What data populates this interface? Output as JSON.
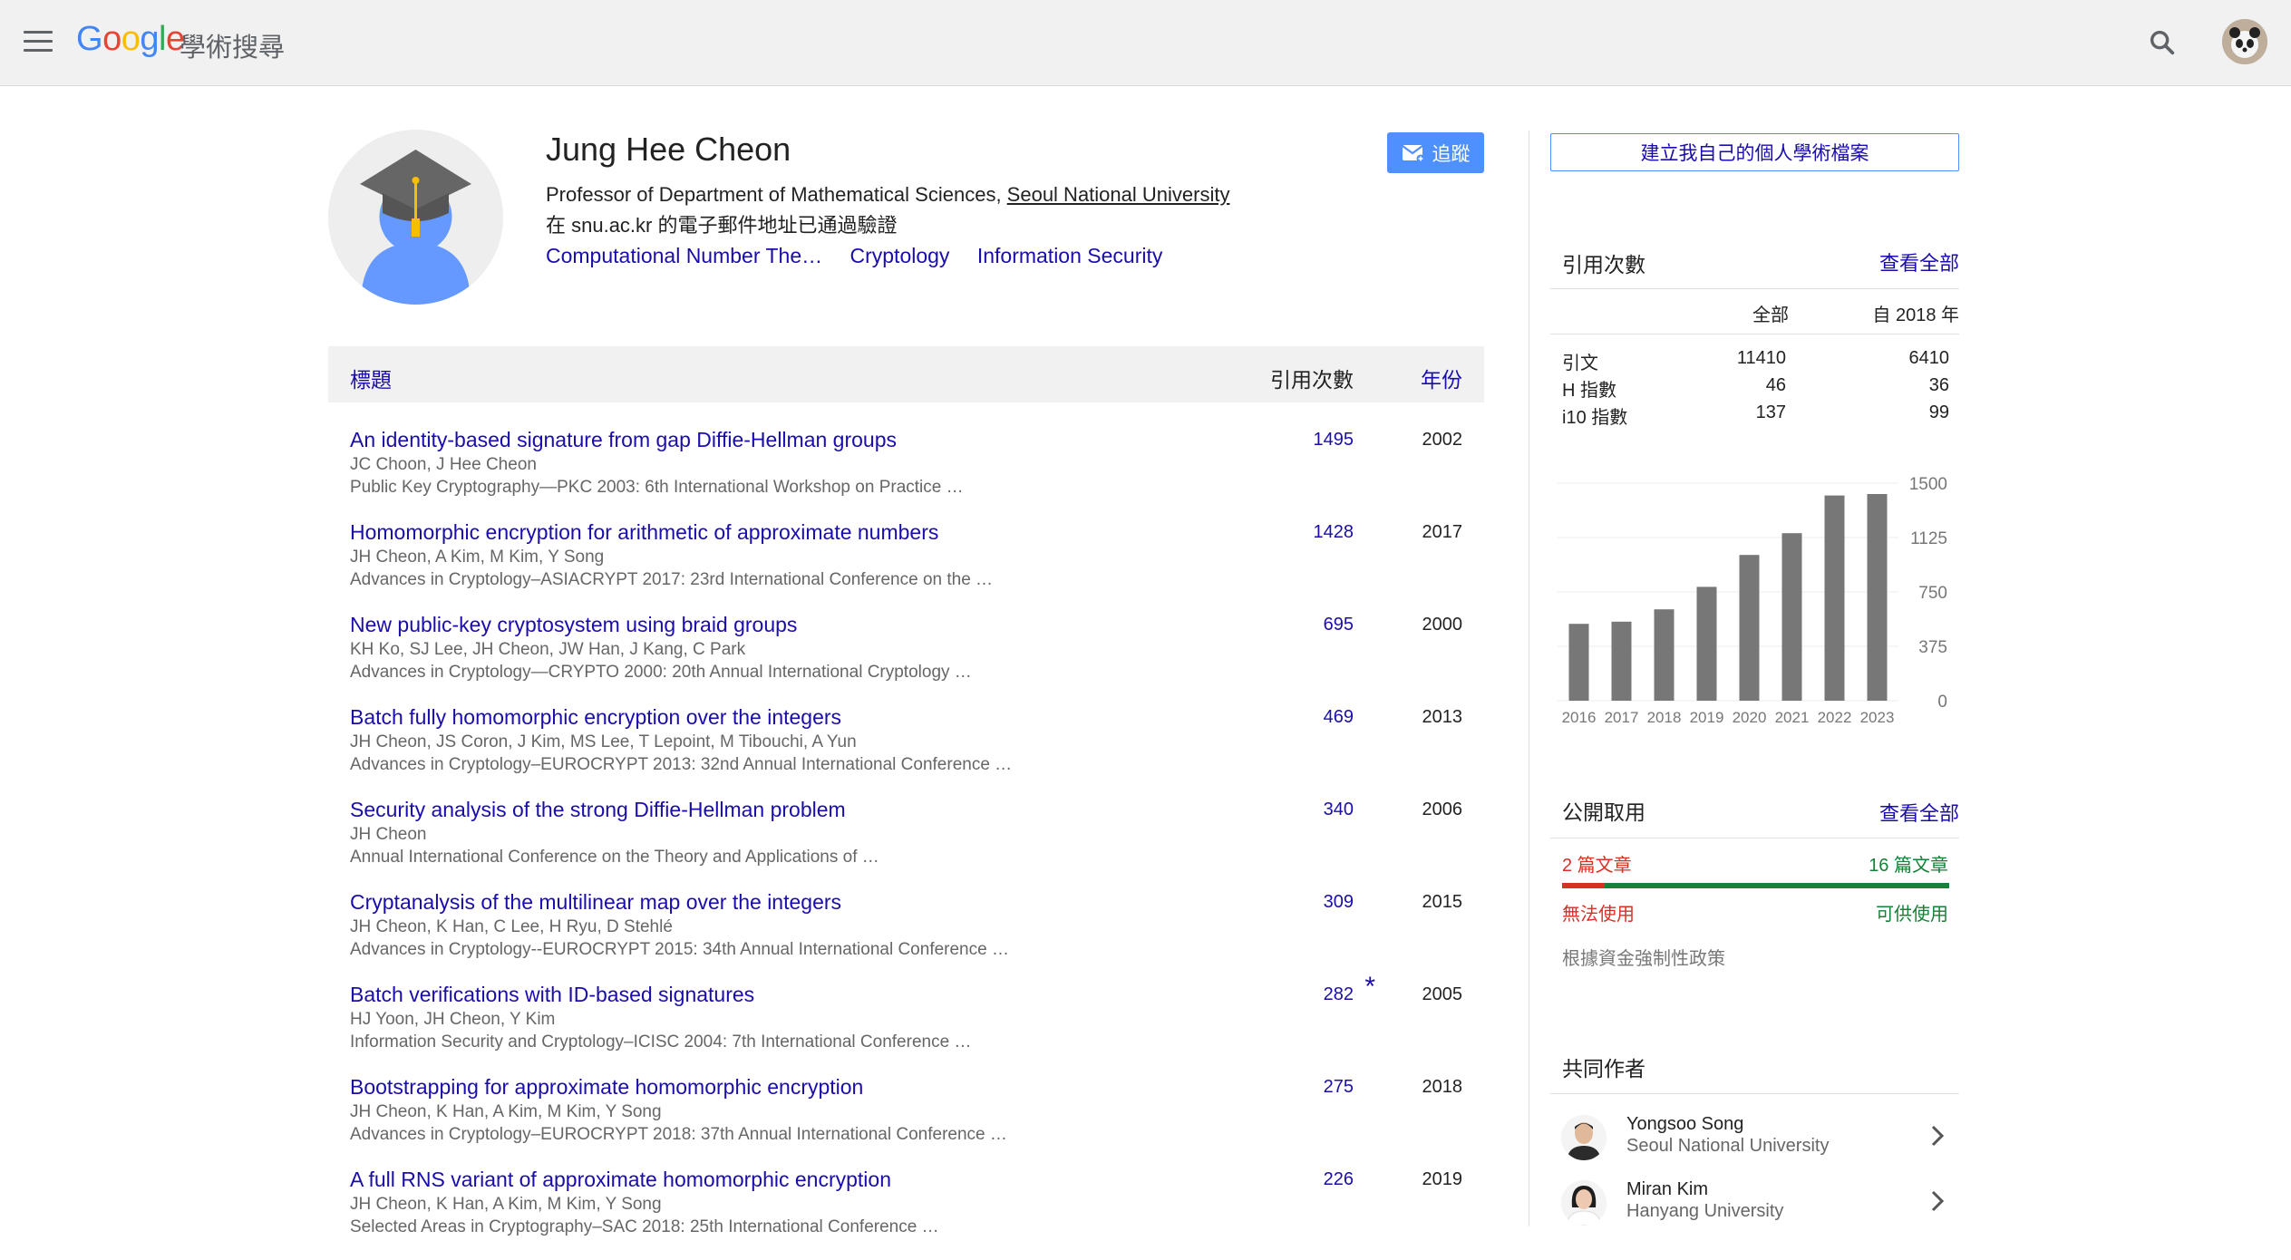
{
  "header": {
    "logo_letters": [
      "G",
      "o",
      "o",
      "g",
      "l",
      "e"
    ],
    "logo_sub": "學術搜尋"
  },
  "profile": {
    "name": "Jung Hee Cheon",
    "affiliation_prefix": "Professor of Department of Mathematical Sciences, ",
    "affiliation_link": "Seoul National University",
    "verified": "在 snu.ac.kr 的電子郵件地址已通過驗證",
    "interests": [
      "Computational Number The…",
      "Cryptology",
      "Information Security"
    ],
    "follow_label": "追蹤"
  },
  "table": {
    "col_title": "標題",
    "col_cited": "引用次數",
    "col_year": "年份",
    "rows": [
      {
        "title": "An identity-based signature from gap Diffie-Hellman groups",
        "authors": "JC Choon, J Hee Cheon",
        "venue": "Public Key Cryptography—PKC 2003: 6th International Workshop on Practice …",
        "cited": "1495",
        "year": "2002",
        "star": ""
      },
      {
        "title": "Homomorphic encryption for arithmetic of approximate numbers",
        "authors": "JH Cheon, A Kim, M Kim, Y Song",
        "venue": "Advances in Cryptology–ASIACRYPT 2017: 23rd International Conference on the …",
        "cited": "1428",
        "year": "2017",
        "star": ""
      },
      {
        "title": "New public-key cryptosystem using braid groups",
        "authors": "KH Ko, SJ Lee, JH Cheon, JW Han, J Kang, C Park",
        "venue": "Advances in Cryptology—CRYPTO 2000: 20th Annual International Cryptology …",
        "cited": "695",
        "year": "2000",
        "star": ""
      },
      {
        "title": "Batch fully homomorphic encryption over the integers",
        "authors": "JH Cheon, JS Coron, J Kim, MS Lee, T Lepoint, M Tibouchi, A Yun",
        "venue": "Advances in Cryptology–EUROCRYPT 2013: 32nd Annual International Conference …",
        "cited": "469",
        "year": "2013",
        "star": ""
      },
      {
        "title": "Security analysis of the strong Diffie-Hellman problem",
        "authors": "JH Cheon",
        "venue": "Annual International Conference on the Theory and Applications of …",
        "cited": "340",
        "year": "2006",
        "star": ""
      },
      {
        "title": "Cryptanalysis of the multilinear map over the integers",
        "authors": "JH Cheon, K Han, C Lee, H Ryu, D Stehlé",
        "venue": "Advances in Cryptology--EUROCRYPT 2015: 34th Annual International Conference …",
        "cited": "309",
        "year": "2015",
        "star": ""
      },
      {
        "title": "Batch verifications with ID-based signatures",
        "authors": "HJ Yoon, JH Cheon, Y Kim",
        "venue": "Information Security and Cryptology–ICISC 2004: 7th International Conference …",
        "cited": "282",
        "year": "2005",
        "star": "*"
      },
      {
        "title": "Bootstrapping for approximate homomorphic encryption",
        "authors": "JH Cheon, K Han, A Kim, M Kim, Y Song",
        "venue": "Advances in Cryptology–EUROCRYPT 2018: 37th Annual International Conference …",
        "cited": "275",
        "year": "2018",
        "star": ""
      },
      {
        "title": "A full RNS variant of approximate homomorphic encryption",
        "authors": "JH Cheon, K Han, A Kim, M Kim, Y Song",
        "venue": "Selected Areas in Cryptography–SAC 2018: 25th International Conference …",
        "cited": "226",
        "year": "2019",
        "star": ""
      }
    ]
  },
  "sidebar": {
    "create_profile": "建立我自己的個人學術檔案",
    "citations": {
      "title": "引用次數",
      "view_all": "查看全部",
      "col_all": "全部",
      "col_since": "自 2018 年",
      "rows": [
        {
          "label": "引文",
          "all": "11410",
          "since": "6410"
        },
        {
          "label": "H 指數",
          "all": "46",
          "since": "36"
        },
        {
          "label": "i10 指數",
          "all": "137",
          "since": "99"
        }
      ]
    },
    "open_access": {
      "title": "公開取用",
      "view_all": "查看全部",
      "unavailable_count": "2 篇文章",
      "available_count": "16 篇文章",
      "unavailable_label": "無法使用",
      "available_label": "可供使用",
      "unavailable_fraction": 0.111,
      "mandate": "根據資金強制性政策"
    },
    "coauthors": {
      "title": "共同作者",
      "items": [
        {
          "name": "Yongsoo Song",
          "affiliation": "Seoul National University"
        },
        {
          "name": "Miran Kim",
          "affiliation": "Hanyang University"
        }
      ]
    }
  },
  "colors": {
    "link": "#1a0dab",
    "accent_button": "#4d90fe",
    "bar": "#777777",
    "oa_red": "#d93025",
    "oa_green": "#188038"
  },
  "chart_data": {
    "type": "bar",
    "categories": [
      "2016",
      "2017",
      "2018",
      "2019",
      "2020",
      "2021",
      "2022",
      "2023"
    ],
    "values": [
      530,
      545,
      630,
      785,
      1005,
      1155,
      1415,
      1425
    ],
    "yticks": [
      "0",
      "375",
      "750",
      "1125",
      "1500"
    ],
    "ylim": [
      0,
      1500
    ],
    "grid": true
  }
}
